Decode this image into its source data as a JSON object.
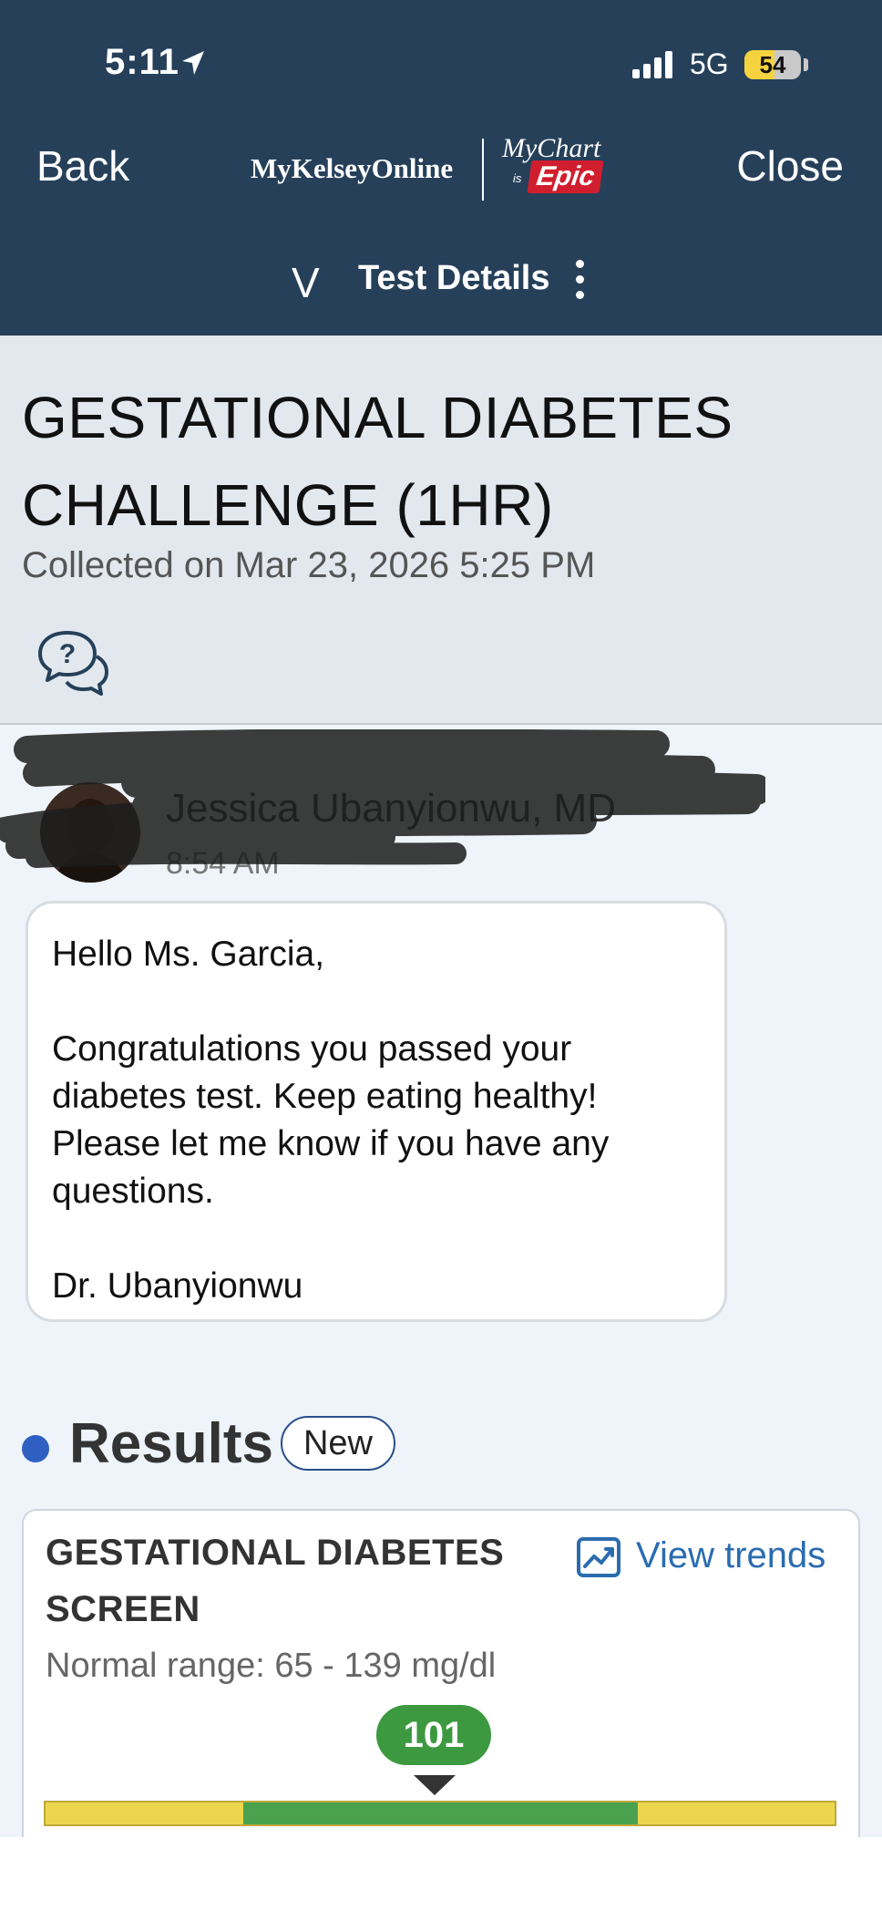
{
  "status_bar": {
    "time": "5:11",
    "network": "5G",
    "battery_level": "54",
    "battery_fraction": 0.54
  },
  "nav": {
    "back_label": "Back",
    "close_label": "Close",
    "brand_left": "MyKelseyOnline",
    "brand_right_top": "MyChart",
    "brand_right_is": "is",
    "brand_right_epic": "Epic",
    "chevron": "V",
    "page_title": "Test Details"
  },
  "test": {
    "name": "GESTATIONAL DIABETES CHALLENGE (1HR)",
    "collected": "Collected on Mar 23, 2026 5:25 PM"
  },
  "message": {
    "sender": "Jessica Ubanyionwu, MD",
    "time": "8:54 AM",
    "greeting": "Hello Ms. Garcia,",
    "body": "Congratulations you passed your diabetes test. Keep eating healthy! Please let me know if you have any questions.",
    "signature": "Dr. Ubanyionwu"
  },
  "results": {
    "title": "Results",
    "badge": "New",
    "component": {
      "name": "GESTATIONAL DIABETES SCREEN",
      "view_trends_label": "View trends",
      "normal_range": "Normal range: 65 - 139 mg/dl",
      "value": "101",
      "range_low": 65,
      "range_high": 139,
      "value_num": 101
    }
  },
  "colors": {
    "header_bg": "#26405a",
    "in_range": "#4aa24e",
    "out_of_range": "#ecd64e",
    "value_pill": "#3d9940",
    "link": "#2a6cb0",
    "results_dot": "#2f5fc1"
  }
}
